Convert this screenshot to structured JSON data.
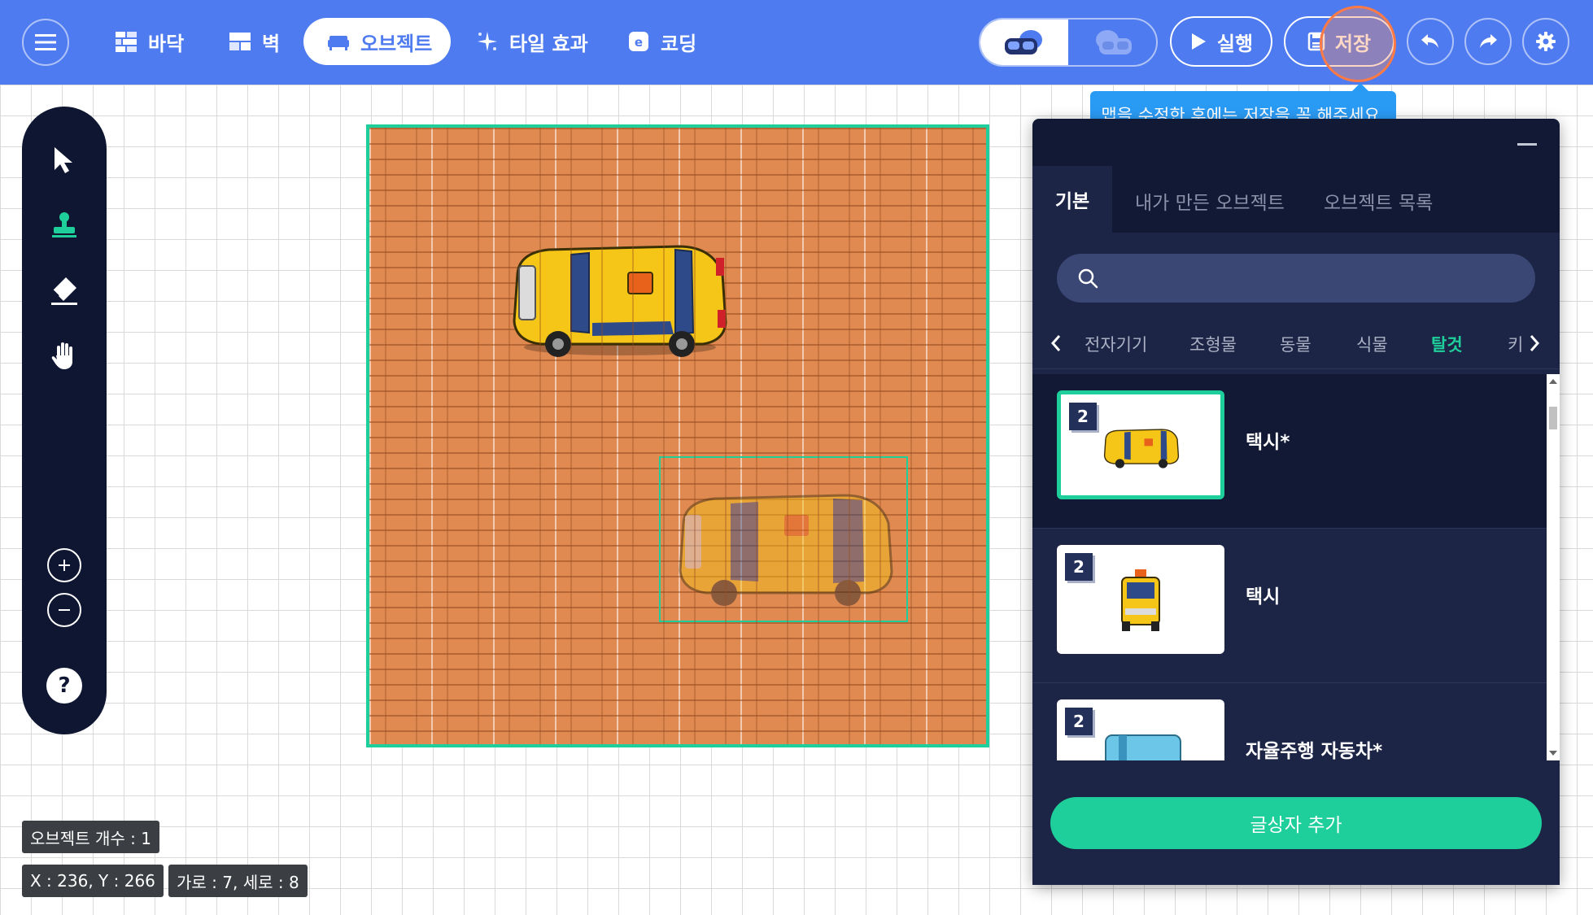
{
  "nav": {
    "items": [
      {
        "label": "바닥",
        "icon": "floor-icon"
      },
      {
        "label": "벽",
        "icon": "wall-icon"
      },
      {
        "label": "오브젝트",
        "icon": "sofa-icon"
      },
      {
        "label": "타일 효과",
        "icon": "sparkle-icon"
      },
      {
        "label": "코딩",
        "icon": "code-icon"
      }
    ],
    "active_index": 2
  },
  "toolbar_right": {
    "run_label": "실행",
    "save_label": "저장"
  },
  "tooltip": "맵을 수정한 후에는 저장을 꼭 해주세요.",
  "panel": {
    "tabs": [
      "기본",
      "내가 만든 오브젝트",
      "오브젝트 목록"
    ],
    "active_tab": 0,
    "search": {
      "placeholder": "",
      "value": ""
    },
    "categories": [
      "전자기기",
      "조형물",
      "동물",
      "식물",
      "탈것",
      "키"
    ],
    "active_category": 4,
    "items": [
      {
        "badge": "2",
        "name": "택시*",
        "selected": true
      },
      {
        "badge": "2",
        "name": "택시",
        "selected": false
      },
      {
        "badge": "2",
        "name": "자율주행 자동차*",
        "selected": false
      }
    ],
    "add_button": "글상자 추가"
  },
  "status": {
    "object_count": "오브젝트 개수 : 1",
    "coords": "X : 236, Y : 266",
    "size": "가로 : 7, 세로 : 8"
  },
  "colors": {
    "topbar": "#4f7bf0",
    "accent": "#1ecf9b",
    "panel": "#111935",
    "tooltip": "#2a9bf5"
  }
}
